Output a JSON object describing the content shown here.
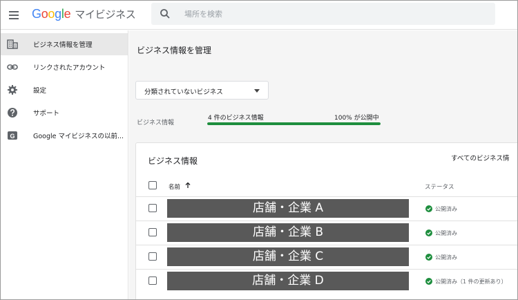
{
  "header": {
    "logo_letters": [
      "G",
      "o",
      "o",
      "g",
      "l",
      "e"
    ],
    "product": "マイビジネス",
    "search_placeholder": "場所を検索",
    "icons": [
      "menu-icon",
      "search-icon"
    ]
  },
  "sidebar": {
    "items": [
      {
        "label": "ビジネス情報を管理",
        "icon": "building-icon",
        "active": true
      },
      {
        "label": "リンクされたアカウント",
        "icon": "link-icon",
        "active": false
      },
      {
        "label": "設定",
        "icon": "gear-icon",
        "active": false
      },
      {
        "label": "サポート",
        "icon": "help-icon",
        "active": false
      },
      {
        "label": "Google マイビジネスの以前...",
        "icon": "gmb-classic-icon",
        "active": false
      }
    ]
  },
  "main": {
    "page_title": "ビジネス情報を管理",
    "filter_dropdown": "分類されていないビジネス",
    "info_label": "ビジネス情報",
    "progress": {
      "count_text": "4 件のビジネス情報",
      "percent_text": "100% が公開中",
      "value": 1.0,
      "color": "#1e8e3e"
    },
    "card": {
      "title": "ビジネス情報",
      "all_link": "すべてのビジネス情",
      "columns": {
        "name": "名前",
        "status": "ステータス"
      },
      "rows": [
        {
          "name": "店舗・企業 A",
          "status": "公開済み"
        },
        {
          "name": "店舗・企業 B",
          "status": "公開済み"
        },
        {
          "name": "店舗・企業 C",
          "status": "公開済み"
        },
        {
          "name": "店舗・企業 D",
          "status": "公開済み（1 件の更新あり）"
        }
      ]
    }
  }
}
